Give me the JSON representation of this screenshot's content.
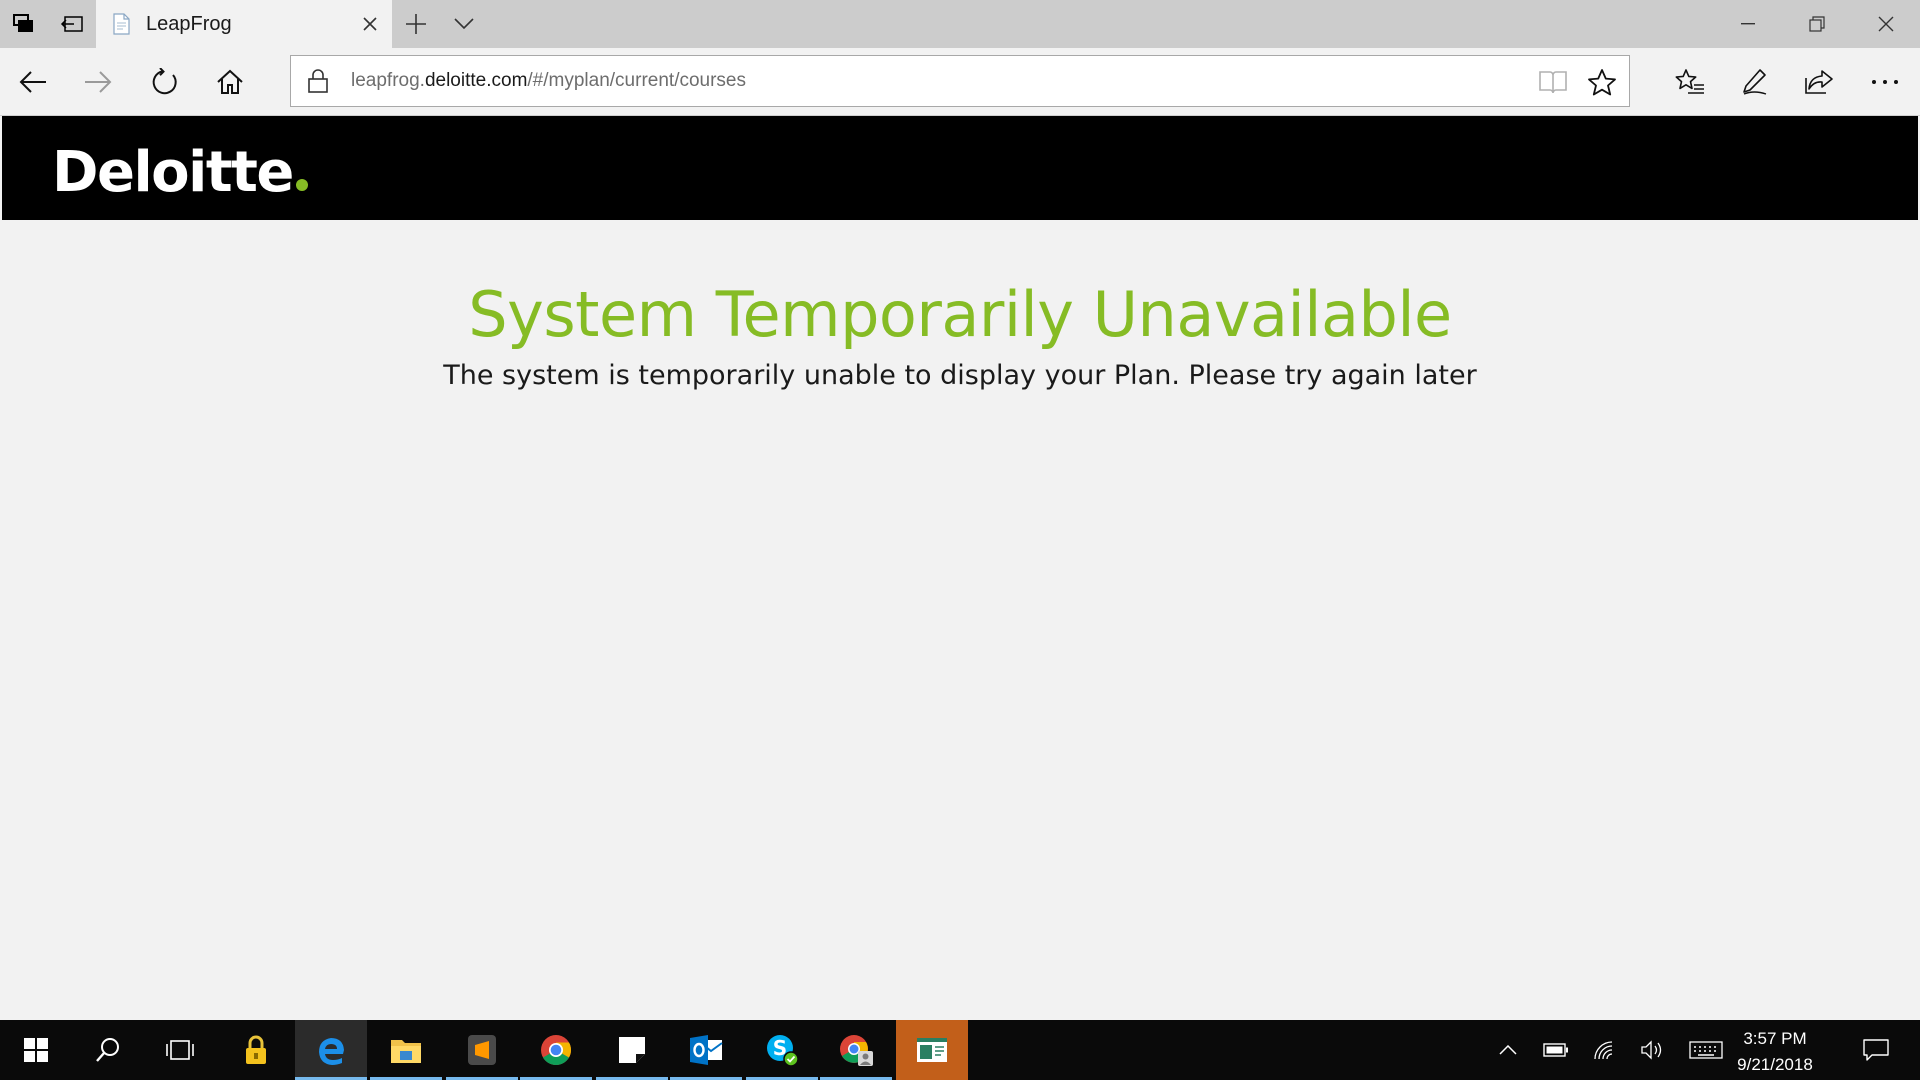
{
  "browser": {
    "tab_title": "LeapFrog",
    "url_prefix": "leapfrog.",
    "url_domain": "deloitte.com",
    "url_path": "/#/myplan/current/courses"
  },
  "site": {
    "logo_text": "Deloitte",
    "brand_color": "#86bc25"
  },
  "error": {
    "title": "System Temporarily Unavailable",
    "message": "The system is temporarily unable to display your Plan. Please try again later"
  },
  "taskbar": {
    "apps": [
      "start",
      "search",
      "task-view",
      "keepass",
      "edge",
      "file-explorer",
      "sublime-text",
      "chrome",
      "sticky-notes",
      "outlook",
      "skype",
      "chrome-profile",
      "app-window"
    ],
    "time": "3:57 PM",
    "date": "9/21/2018"
  }
}
